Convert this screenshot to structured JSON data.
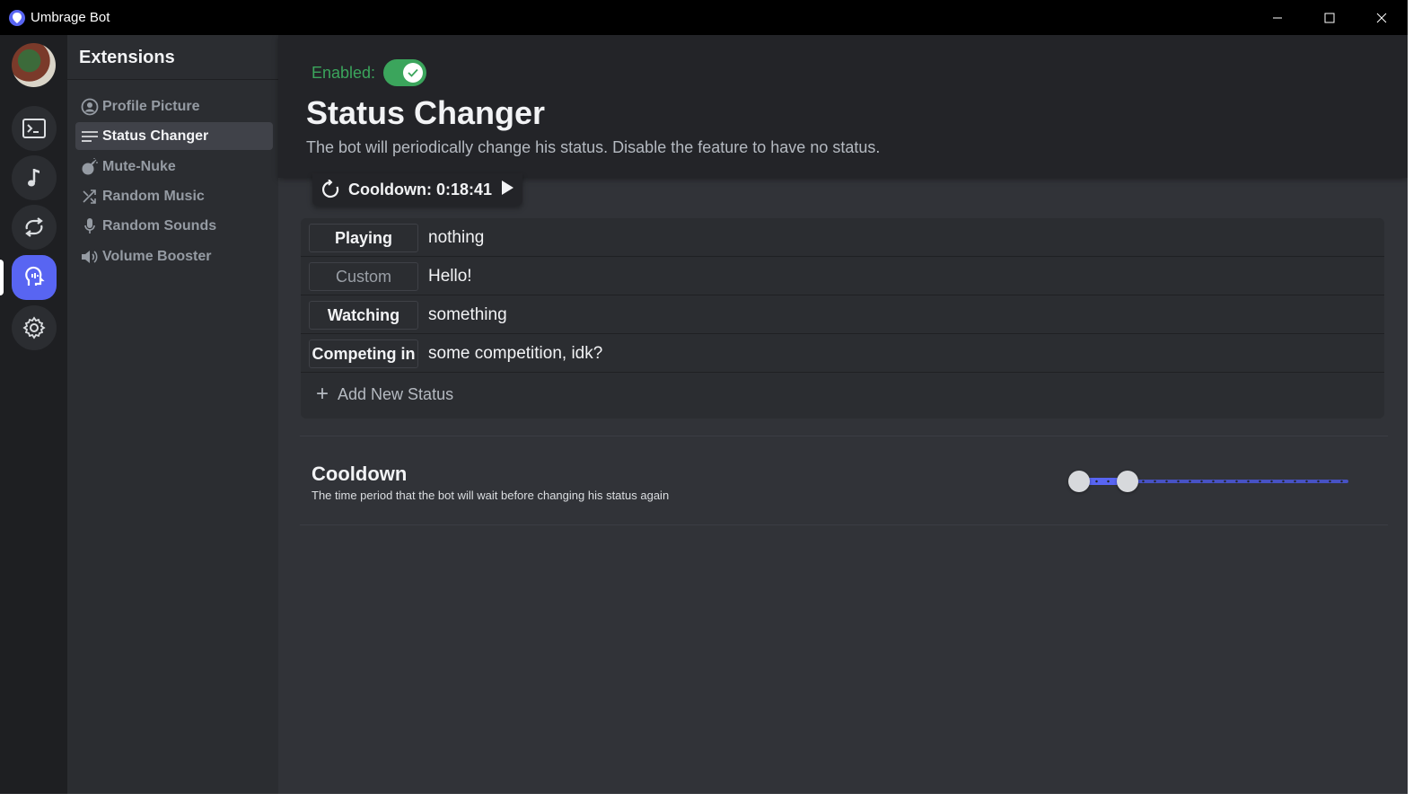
{
  "window": {
    "title": "Umbrage Bot",
    "controls": [
      "minimize-icon",
      "maximize-icon",
      "close-icon"
    ]
  },
  "rail": {
    "items": [
      {
        "name": "terminal-icon"
      },
      {
        "name": "music-note-icon"
      },
      {
        "name": "repeat-icon"
      },
      {
        "name": "extensions-icon",
        "active": true
      },
      {
        "name": "gear-icon"
      }
    ]
  },
  "sidebar": {
    "title": "Extensions",
    "items": [
      {
        "label": "Profile Picture",
        "icon": "user-circle-icon"
      },
      {
        "label": "Status Changer",
        "icon": "lines-icon",
        "active": true
      },
      {
        "label": "Mute-Nuke",
        "icon": "bomb-icon"
      },
      {
        "label": "Random Music",
        "icon": "shuffle-icon"
      },
      {
        "label": "Random Sounds",
        "icon": "microphone-icon"
      },
      {
        "label": "Volume Booster",
        "icon": "speaker-icon"
      }
    ]
  },
  "header": {
    "enabled_label": "Enabled:",
    "enabled": true,
    "title": "Status Changer",
    "description": "The bot will periodically change his status. Disable the feature to have no status."
  },
  "cooldown_chip": {
    "text": "Cooldown: 0:18:41"
  },
  "statuses": [
    {
      "type": "Playing",
      "text": "nothing"
    },
    {
      "type": "Custom",
      "text": "Hello!",
      "dim": true
    },
    {
      "type": "Watching",
      "text": "something"
    },
    {
      "type": "Competing in",
      "text": "some competition, idk?"
    }
  ],
  "add_status_label": "Add New Status",
  "cooldown_setting": {
    "title": "Cooldown",
    "description": "The time period that the bot will wait before changing his status again",
    "range_min_fraction": 0.0,
    "range_max_fraction": 0.18
  },
  "colors": {
    "accent": "#5865f2",
    "enabled_green": "#3ba55c"
  }
}
